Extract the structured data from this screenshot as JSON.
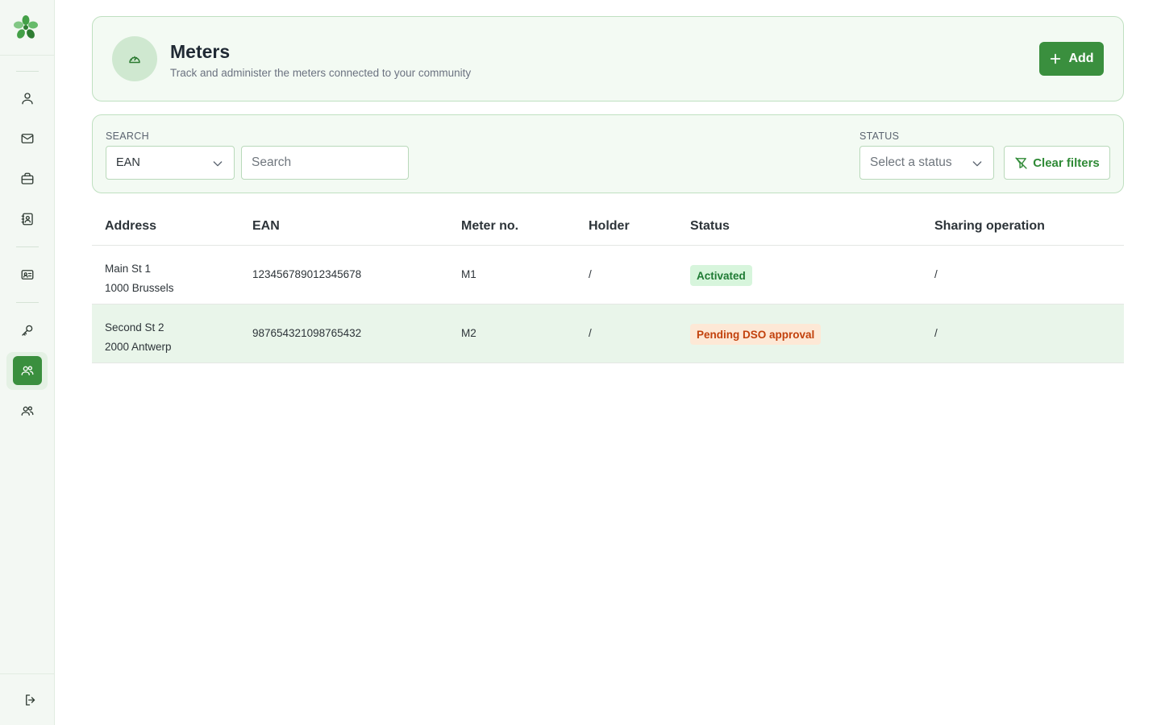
{
  "sidebar": {
    "items": [
      {
        "icon": "user-icon"
      },
      {
        "icon": "mail-icon"
      },
      {
        "icon": "briefcase-icon"
      },
      {
        "icon": "contact-book-icon"
      },
      {
        "icon": "id-card-icon"
      },
      {
        "icon": "key-icon"
      },
      {
        "icon": "users-icon",
        "active": true
      },
      {
        "icon": "users-icon"
      }
    ],
    "logout_icon": "logout-icon",
    "accent": "#3a8f3e"
  },
  "header": {
    "title": "Meters",
    "subtitle": "Track and administer the meters connected to your community",
    "icon": "gauge-icon",
    "add_label": "Add"
  },
  "filters": {
    "search_label": "SEARCH",
    "search_field_value": "EAN",
    "search_placeholder": "Search",
    "status_label": "STATUS",
    "status_placeholder": "Select a status",
    "clear_label": "Clear filters"
  },
  "table": {
    "columns": [
      "Address",
      "EAN",
      "Meter no.",
      "Holder",
      "Status",
      "Sharing operation"
    ],
    "rows": [
      {
        "address_line1": "Main St 1",
        "address_line2": "1000 Brussels",
        "ean": "123456789012345678",
        "meter_no": "M1",
        "holder": "/",
        "status": "Activated",
        "status_color": "green",
        "sharing": "/"
      },
      {
        "address_line1": "Second St 2",
        "address_line2": "2000 Antwerp",
        "ean": "987654321098765432",
        "meter_no": "M2",
        "holder": "/",
        "status": "Pending DSO approval",
        "status_color": "orange",
        "sharing": "/"
      }
    ]
  }
}
